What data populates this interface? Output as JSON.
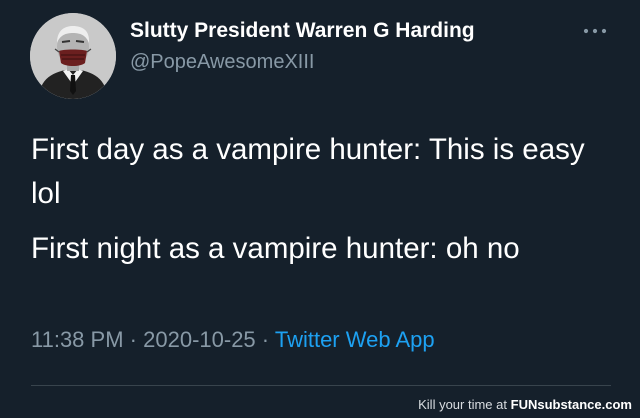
{
  "tweet": {
    "display_name": "Slutty President Warren G Harding",
    "handle": "@PopeAwesomeXIII",
    "avatar_icon": "profile-photo-avatar",
    "more_icon": "more-horizontal-icon",
    "paragraphs": [
      "First day as a vampire hunter: This is easy lol",
      "First night as a vampire hunter: oh no"
    ],
    "time": "11:38 PM",
    "separator": "·",
    "date": "2020-10-25",
    "source": "Twitter Web App"
  },
  "watermark": {
    "prefix": "Kill your time at",
    "brand": "FUNsubstance.com"
  },
  "colors": {
    "background": "#15202b",
    "text": "#ffffff",
    "secondary_text": "#8899a6",
    "link": "#1da1f2",
    "divider": "#38444d"
  }
}
